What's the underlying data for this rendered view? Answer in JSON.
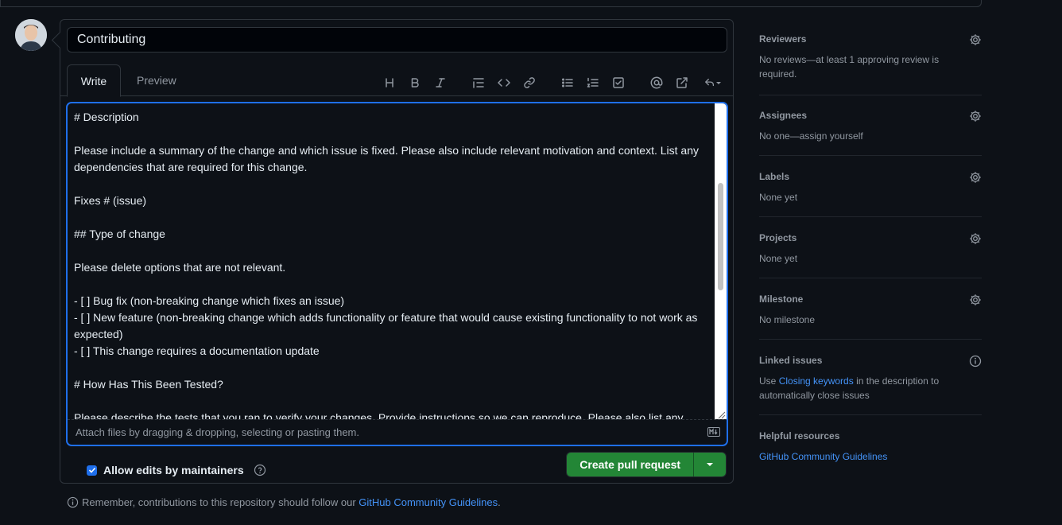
{
  "title_input": {
    "value": "Contributing"
  },
  "tabs": {
    "write": "Write",
    "preview": "Preview"
  },
  "toolbar": {
    "heading_icon": "heading-icon",
    "bold_icon": "bold-icon",
    "italic_icon": "italic-icon",
    "quote_icon": "quote-icon",
    "code_icon": "code-icon",
    "link_icon": "link-icon",
    "unordered_list_icon": "unordered-list-icon",
    "ordered_list_icon": "ordered-list-icon",
    "task_list_icon": "task-list-icon",
    "mention_icon": "mention-icon",
    "reference_icon": "cross-reference-icon",
    "saved_replies_icon": "reply-icon"
  },
  "body": {
    "text": "# Description\n\nPlease include a summary of the change and which issue is fixed. Please also include relevant motivation and context. List any dependencies that are required for this change.\n\nFixes # (issue)\n\n## Type of change\n\nPlease delete options that are not relevant.\n\n- [ ] Bug fix (non-breaking change which fixes an issue)\n- [ ] New feature (non-breaking change which adds functionality or feature that would cause existing functionality to not work as expected)\n- [ ] This change requires a documentation update\n\n# How Has This Been Tested?\n\nPlease describe the tests that you ran to verify your changes. Provide instructions so we can reproduce. Please also list any"
  },
  "attach": {
    "text": "Attach files by dragging & dropping, selecting or pasting them."
  },
  "allow_edits": {
    "label": "Allow edits by maintainers",
    "checked": true
  },
  "create_button": {
    "label": "Create pull request"
  },
  "footnote": {
    "prefix": "Remember, contributions to this repository should follow our ",
    "link": "GitHub Community Guidelines",
    "suffix": "."
  },
  "sidebar": {
    "reviewers": {
      "title": "Reviewers",
      "text": "No reviews—at least 1 approving review is required."
    },
    "assignees": {
      "title": "Assignees",
      "text": "No one—assign yourself"
    },
    "labels": {
      "title": "Labels",
      "text": "None yet"
    },
    "projects": {
      "title": "Projects",
      "text": "None yet"
    },
    "milestone": {
      "title": "Milestone",
      "text": "No milestone"
    },
    "linked_issues": {
      "title": "Linked issues",
      "text_prefix": "Use ",
      "link": "Closing keywords",
      "text_suffix": " in the description to automatically close issues"
    },
    "helpful": {
      "title": "Helpful resources",
      "link": "GitHub Community Guidelines"
    }
  },
  "colors": {
    "background": "#0d1117",
    "accent": "#1f6feb",
    "link": "#4493f8",
    "button": "#238636",
    "muted": "#9198a1"
  }
}
